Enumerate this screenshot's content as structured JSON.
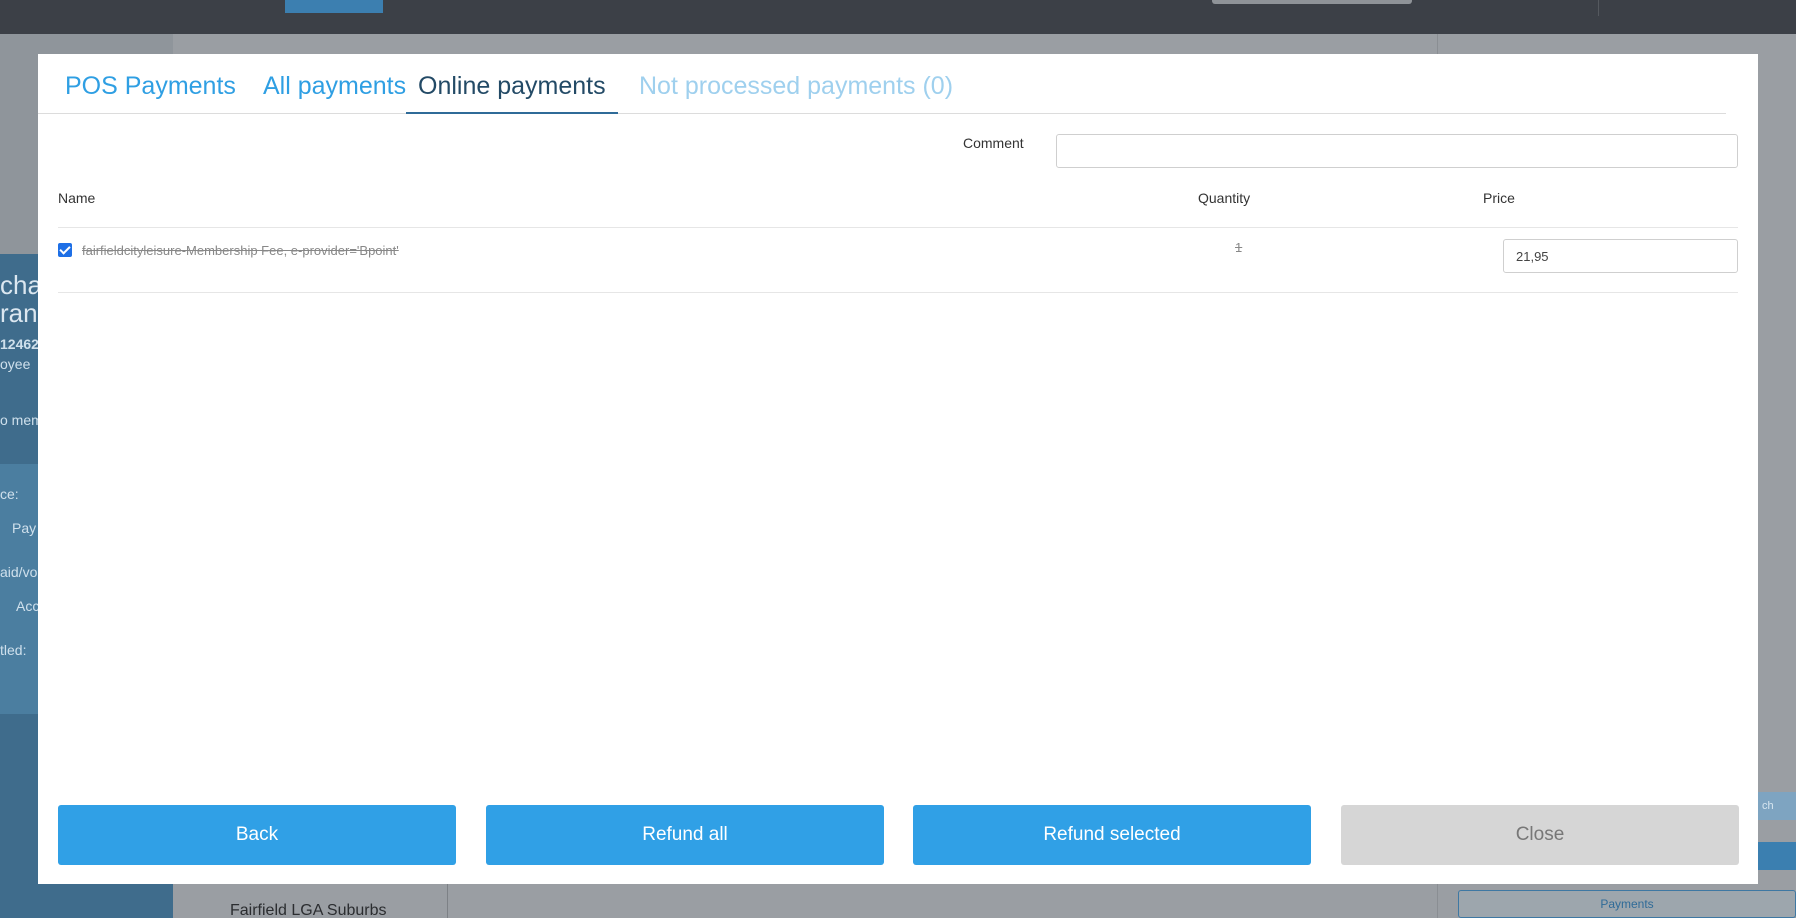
{
  "background": {
    "left_panel_texts": [
      "cha",
      "ran",
      "12462",
      "oyee",
      "o mem",
      "ce:",
      "Pay",
      "aid/vou",
      "Acco",
      "tled:"
    ],
    "bottom_text": "Fairfield LGA Suburbs",
    "right_button": "ch",
    "payments_button": "Payments"
  },
  "tabs": [
    {
      "label": "POS Payments",
      "state": "normal"
    },
    {
      "label": "All payments",
      "state": "normal"
    },
    {
      "label": "Online payments",
      "state": "active"
    },
    {
      "label": "Not processed payments (0)",
      "state": "disabled"
    }
  ],
  "comment": {
    "label": "Comment",
    "value": ""
  },
  "table": {
    "headers": {
      "name": "Name",
      "quantity": "Quantity",
      "price": "Price"
    },
    "rows": [
      {
        "checked": true,
        "name": "fairfieldcityleisure-Membership Fee, e-provider='Bpoint'",
        "quantity": "1",
        "price": "21,95"
      }
    ]
  },
  "buttons": {
    "back": "Back",
    "refund_all": "Refund all",
    "refund_selected": "Refund selected",
    "close": "Close"
  },
  "colors": {
    "accent": "#30a0e6",
    "active_tab": "#234a66",
    "disabled_tab": "#9fd0ee",
    "close_button": "#d6d6d6"
  }
}
